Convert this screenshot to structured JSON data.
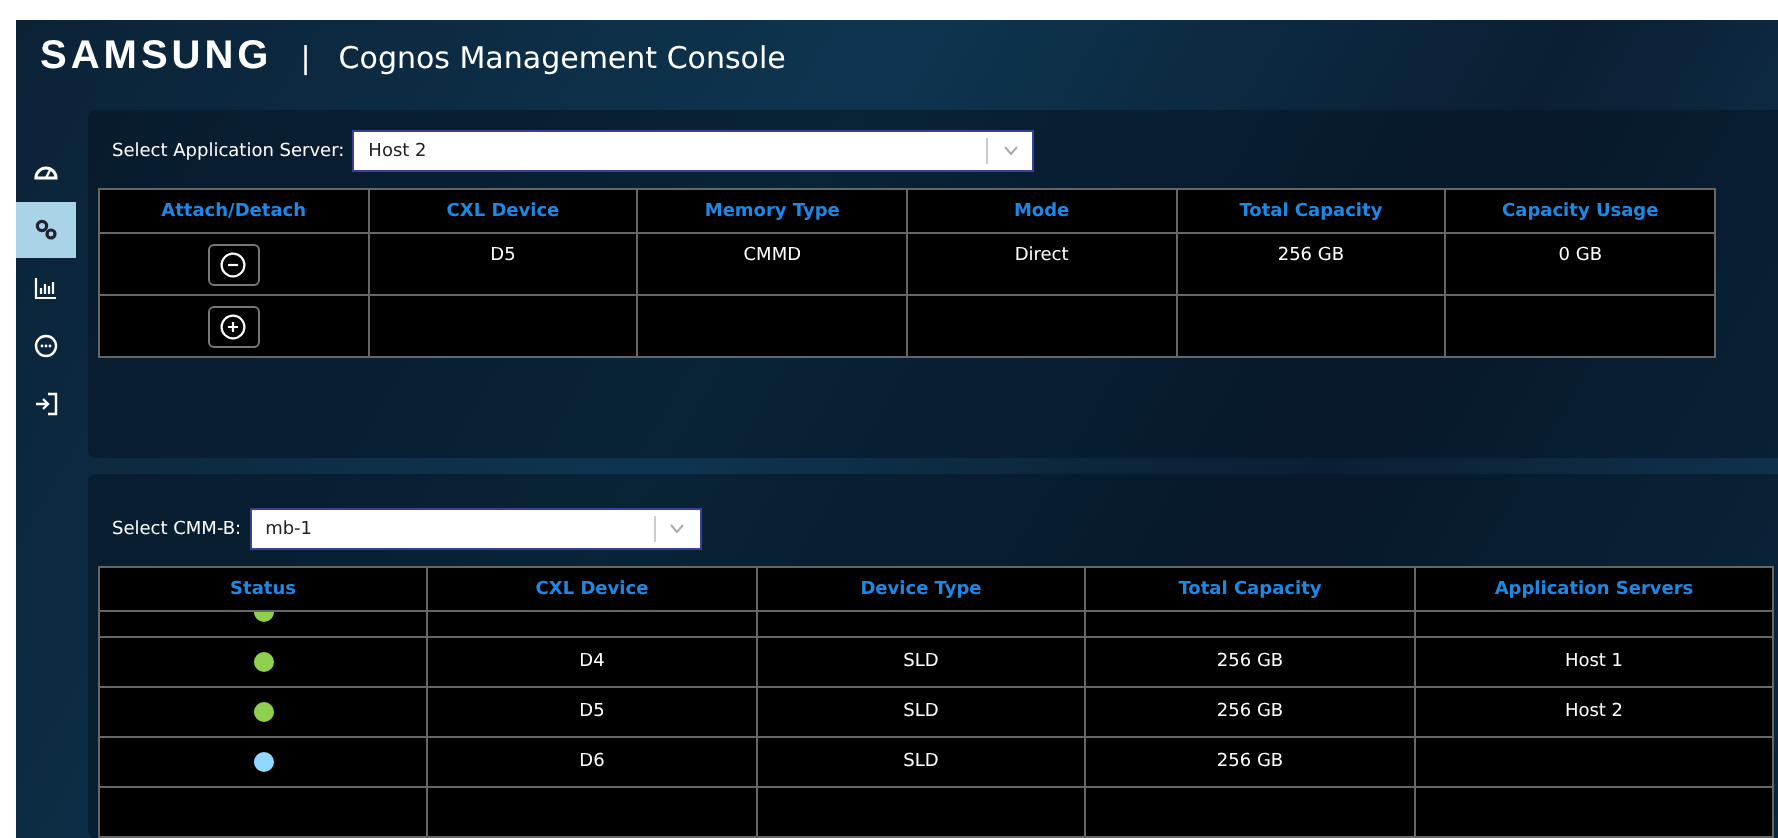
{
  "header": {
    "brand": "SAMSUNG",
    "separator": "|",
    "title": "Cognos Management Console"
  },
  "sidebar": {
    "items": [
      {
        "kind": "gauge",
        "selected": false
      },
      {
        "kind": "gears",
        "selected": true
      },
      {
        "kind": "chart",
        "selected": false
      },
      {
        "kind": "more",
        "selected": false
      },
      {
        "kind": "logout",
        "selected": false
      }
    ]
  },
  "server_panel": {
    "label": "Select Application Server:",
    "select_value": "Host 2",
    "table": {
      "columns": [
        "Attach/Detach",
        "CXL Device",
        "Memory Type",
        "Mode",
        "Total Capacity",
        "Capacity Usage"
      ],
      "rows": [
        {
          "kind": "detach",
          "cells": [
            "",
            "D5",
            "CMMD",
            "Direct",
            "256 GB",
            "0 GB"
          ]
        },
        {
          "kind": "attach",
          "cells": []
        }
      ]
    }
  },
  "cmm_panel": {
    "label": "Select CMM-B:",
    "select_value": "mb-1",
    "table": {
      "columns": [
        "Status",
        "CXL Device",
        "Device Type",
        "Total Capacity",
        "Application Servers"
      ],
      "partial_row": {
        "color": "#8fd14f"
      },
      "rows": [
        {
          "color": "#8fd14f",
          "cells": [
            "",
            "D4",
            "SLD",
            "256 GB",
            "Host 1"
          ]
        },
        {
          "color": "#8fd14f",
          "cells": [
            "",
            "D5",
            "SLD",
            "256 GB",
            "Host 2"
          ]
        },
        {
          "color": "#8fd8ff",
          "cells": [
            "",
            "D6",
            "SLD",
            "256 GB"
          ]
        }
      ]
    }
  }
}
